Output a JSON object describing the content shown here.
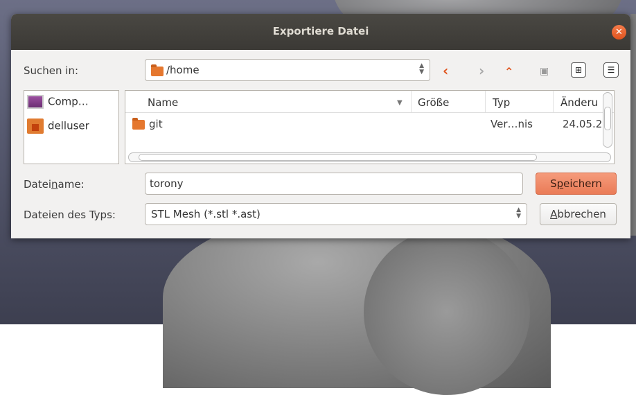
{
  "dialog": {
    "title": "Exportiere Datei",
    "look_in_label": "Suchen in:",
    "look_in_path": "/home",
    "filename_label_pre": "Datei",
    "filename_label_u": "n",
    "filename_label_post": "ame:",
    "filename_value": "torony",
    "filetype_label": "Dateien des Typs:",
    "filetype_value": "STL Mesh (*.stl *.ast)",
    "save_button_pre": "S",
    "save_button_u": "p",
    "save_button_post": "eichern",
    "cancel_button_u": "A",
    "cancel_button_post": "bbrechen"
  },
  "places": [
    {
      "label": "Comp…",
      "icon": "computer-icon"
    },
    {
      "label": "delluser",
      "icon": "home-folder-icon"
    }
  ],
  "file_list": {
    "columns": [
      "Name",
      "Größe",
      "Typ",
      "Änderu"
    ],
    "rows": [
      {
        "name": "git",
        "size": "",
        "type": "Ver…nis",
        "modified": "24.05.2"
      }
    ]
  },
  "colors": {
    "accent": "#ea7b57",
    "titlebar": "#3b3935",
    "folder": "#e5772e"
  }
}
